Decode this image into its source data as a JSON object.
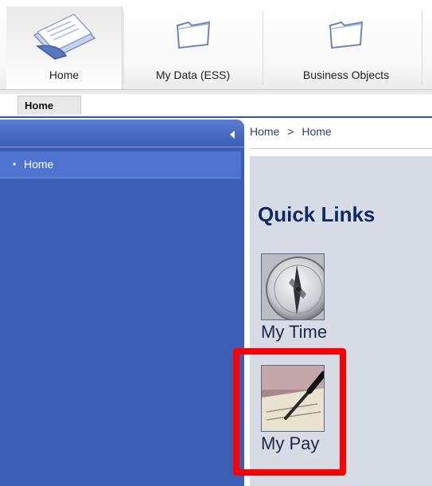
{
  "topnav": {
    "tabs": [
      {
        "label": "Home",
        "icon": "documents-icon"
      },
      {
        "label": "My Data (ESS)",
        "icon": "folder-icon"
      },
      {
        "label": "Business Objects",
        "icon": "folder-icon"
      }
    ]
  },
  "subtabs": {
    "active": "Home"
  },
  "sidebar": {
    "items": [
      {
        "label": "Home"
      }
    ]
  },
  "breadcrumb": {
    "items": [
      "Home",
      ">",
      "Home"
    ]
  },
  "main": {
    "section_title": "Quick Links",
    "quick_links": [
      {
        "label": "My Time",
        "icon": "compass-icon"
      },
      {
        "label": "My Pay",
        "icon": "check-signing-icon"
      }
    ]
  },
  "colors": {
    "sidebar_bg": "#3b5fb4",
    "main_bg": "#d6dbe6",
    "title_color": "#0f2a5e",
    "highlight": "#ff0000"
  }
}
